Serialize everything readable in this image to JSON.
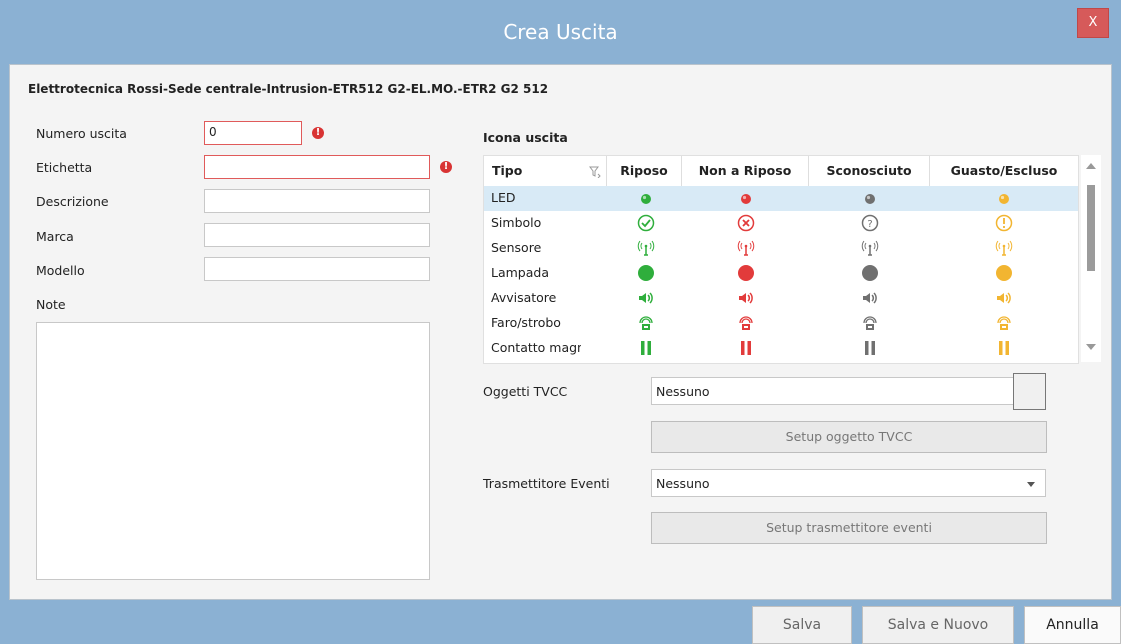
{
  "window": {
    "title": "Crea Uscita",
    "close_label": "X"
  },
  "path": "Elettrotecnica Rossi-Sede centrale-Intrusion-ETR512 G2-EL.MO.-ETR2 G2 512",
  "form": {
    "numero_label": "Numero uscita",
    "numero_value": "0",
    "etichetta_label": "Etichetta",
    "descrizione_label": "Descrizione",
    "marca_label": "Marca",
    "modello_label": "Modello",
    "note_label": "Note"
  },
  "icons_section": {
    "title": "Icona uscita",
    "columns": [
      "Tipo",
      "Riposo",
      "Non a Riposo",
      "Sconosciuto",
      "Guasto/Escluso"
    ],
    "rows": [
      {
        "label": "LED",
        "icon": "led-dot"
      },
      {
        "label": "Simbolo",
        "icon": "symbol"
      },
      {
        "label": "Sensore",
        "icon": "sensor-antenna"
      },
      {
        "label": "Lampada",
        "icon": "lamp-circle"
      },
      {
        "label": "Avvisatore",
        "icon": "speaker"
      },
      {
        "label": "Faro/strobo",
        "icon": "strobe"
      },
      {
        "label": "Contatto magnetico",
        "icon": "magnetic-contact"
      }
    ],
    "colors": {
      "riposo": "#2fae3c",
      "non_riposo": "#e23b3b",
      "sconosciuto": "#707070",
      "guasto": "#f2b531"
    }
  },
  "tvcc": {
    "label": "Oggetti TVCC",
    "value": "Nessuno",
    "setup_label": "Setup oggetto TVCC"
  },
  "trasmettitore": {
    "label": "Trasmettitore Eventi",
    "value": "Nessuno",
    "setup_label": "Setup trasmettitore eventi"
  },
  "footer": {
    "save_label": "Salva",
    "save_new_label": "Salva e Nuovo",
    "cancel_label": "Annulla"
  }
}
